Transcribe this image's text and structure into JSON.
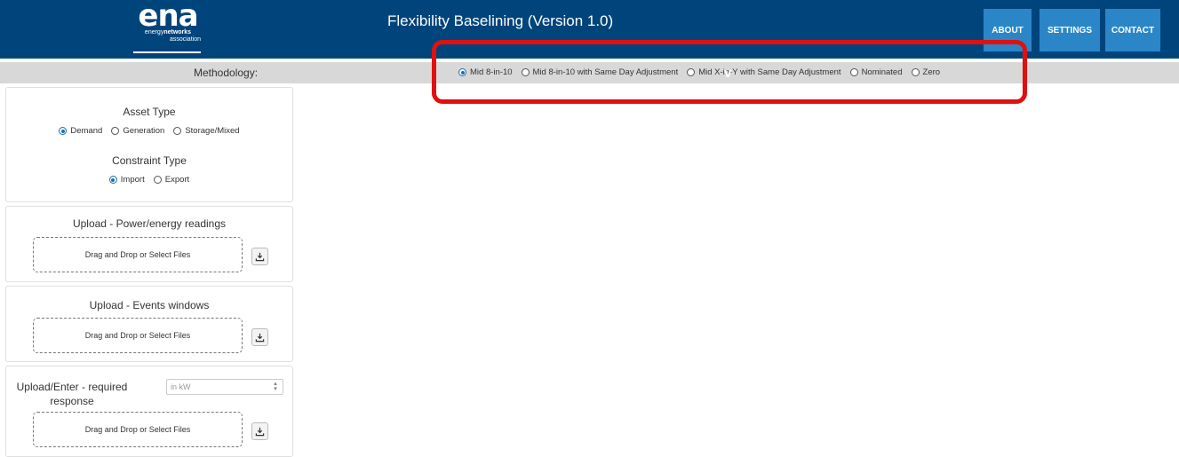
{
  "header": {
    "logo": {
      "mark": "ena",
      "line1_a": "energy",
      "line1_b": "networks",
      "line2": "association"
    },
    "title": "Flexibility Baselining (Version 1.0)",
    "nav": [
      {
        "label": "ABOUT"
      },
      {
        "label": "SETTINGS"
      },
      {
        "label": "CONTACT"
      }
    ],
    "colors": {
      "header_bg": "#00447c",
      "nav_bg": "#2b86c7"
    }
  },
  "methodology": {
    "label": "Methodology:",
    "selected": "Mid 8-in-10",
    "options": [
      {
        "label": "Mid 8-in-10",
        "checked": true
      },
      {
        "label": "Mid 8-in-10 with Same Day Adjustment",
        "checked": false
      },
      {
        "label": "Mid X-in-Y with Same Day Adjustment",
        "checked": false
      },
      {
        "label": "Nominated",
        "checked": false
      },
      {
        "label": "Zero",
        "checked": false
      }
    ],
    "highlight_color": "#e01010"
  },
  "asset": {
    "asset_type_title": "Asset Type",
    "asset_types": [
      {
        "label": "Demand",
        "checked": true
      },
      {
        "label": "Generation",
        "checked": false
      },
      {
        "label": "Storage/Mixed",
        "checked": false
      }
    ],
    "constraint_type_title": "Constraint Type",
    "constraint_types": [
      {
        "label": "Import",
        "checked": true
      },
      {
        "label": "Export",
        "checked": false
      }
    ]
  },
  "uploads": {
    "power": {
      "title": "Upload - Power/energy readings",
      "dropzone": "Drag and Drop or Select Files",
      "icon": "download-icon"
    },
    "events": {
      "title": "Upload - Events windows",
      "dropzone": "Drag and Drop or Select Files",
      "icon": "download-icon"
    },
    "response": {
      "title": "Upload/Enter - required response",
      "input_placeholder": "in kW",
      "input_value": "",
      "dropzone": "Drag and Drop or Select Files",
      "icon": "download-icon"
    }
  }
}
